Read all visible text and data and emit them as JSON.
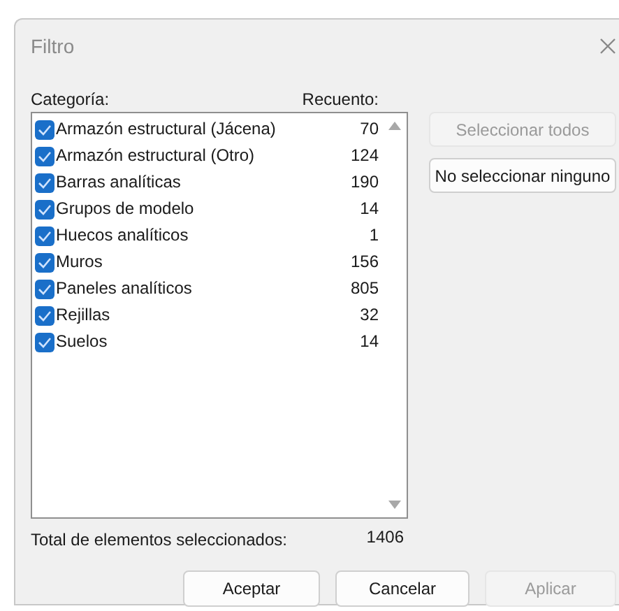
{
  "window": {
    "title": "Filtro"
  },
  "columns": [
    "Categoría:",
    "Recuento:"
  ],
  "categories": [
    {
      "name": "Armazón estructural (Jácena)",
      "count": "70",
      "checked": true
    },
    {
      "name": "Armazón estructural (Otro)",
      "count": "124",
      "checked": true
    },
    {
      "name": "Barras analíticas",
      "count": "190",
      "checked": true
    },
    {
      "name": "Grupos de modelo",
      "count": "14",
      "checked": true
    },
    {
      "name": "Huecos analíticos",
      "count": "1",
      "checked": true
    },
    {
      "name": "Muros",
      "count": "156",
      "checked": true
    },
    {
      "name": "Paneles analíticos",
      "count": "805",
      "checked": true
    },
    {
      "name": "Rejillas",
      "count": "32",
      "checked": true
    },
    {
      "name": "Suelos",
      "count": "14",
      "checked": true
    }
  ],
  "side_buttons": [
    {
      "label": "Seleccionar todos",
      "disabled": true
    },
    {
      "label": "No seleccionar ninguno",
      "disabled": false
    }
  ],
  "total": {
    "label": "Total de elementos seleccionados:",
    "value": "1406"
  },
  "buttons": [
    {
      "label": "Aceptar",
      "disabled": false
    },
    {
      "label": "Cancelar",
      "disabled": false
    },
    {
      "label": "Aplicar",
      "disabled": true
    }
  ]
}
